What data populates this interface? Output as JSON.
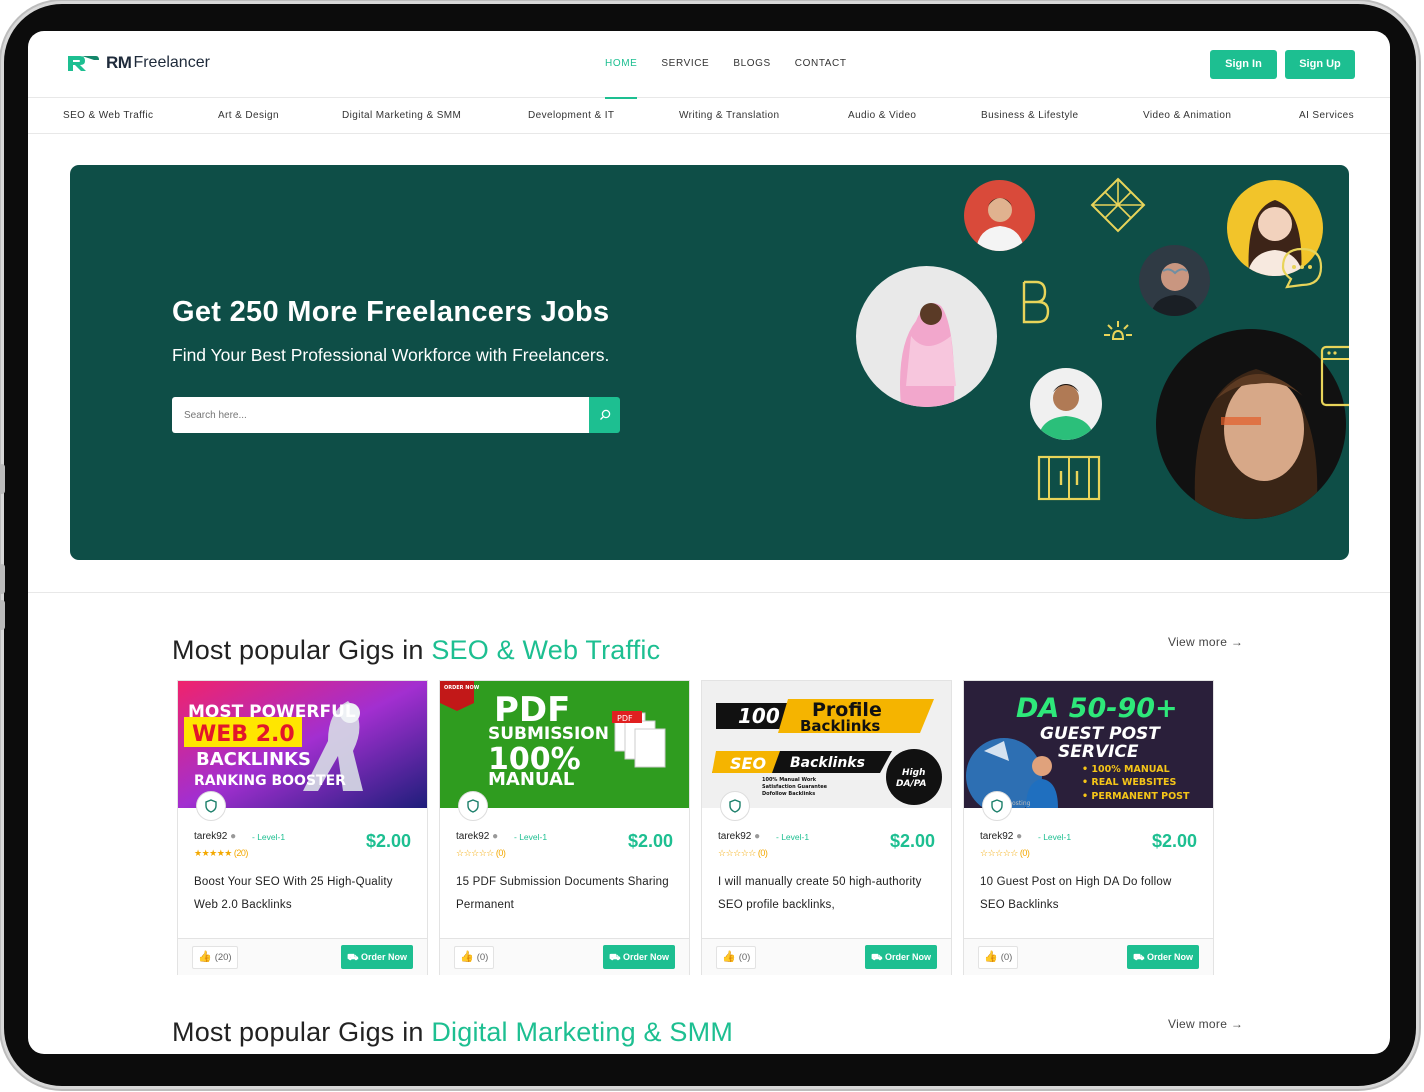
{
  "header": {
    "logo_rm": "RM",
    "logo_freelancer": "Freelancer",
    "nav": [
      "HOME",
      "SERVICE",
      "BLOGS",
      "CONTACT"
    ],
    "sign_in": "Sign In",
    "sign_up": "Sign Up"
  },
  "categories": [
    "SEO & Web Traffic",
    "Art & Design",
    "Digital Marketing & SMM",
    "Development & IT",
    "Writing & Translation",
    "Audio & Video",
    "Business & Lifestyle",
    "Video & Animation",
    "AI Services"
  ],
  "hero": {
    "title": "Get 250 More Freelancers Jobs",
    "subtitle": "Find Your Best Professional Workforce with Freelancers.",
    "search_placeholder": "Search here..."
  },
  "sections": [
    {
      "prefix": "Most popular Gigs in ",
      "highlight": "SEO & Web Traffic",
      "view_more": "View more"
    },
    {
      "prefix": "Most popular Gigs in ",
      "highlight": "Digital Marketing & SMM",
      "view_more": "View more"
    }
  ],
  "gigs": [
    {
      "seller": "tarek92",
      "level": "- Level-1",
      "stars": "★★★★★",
      "rating_count": "(20)",
      "price": "$2.00",
      "title": "Boost Your SEO With 25 High-Quality Web 2.0 Backlinks",
      "likes": "(20)",
      "order": "Order Now",
      "thumb": {
        "l1": "MOST POWERFUL",
        "l2": "WEB 2.0",
        "l3": "BACKLINKS",
        "l4": "RANKING BOOSTER"
      }
    },
    {
      "seller": "tarek92",
      "level": "- Level-1",
      "stars": "☆☆☆☆☆",
      "rating_count": "(0)",
      "price": "$2.00",
      "title": "15 PDF Submission Documents Sharing Permanent",
      "likes": "(0)",
      "order": "Order Now",
      "thumb": {
        "badge": "ORDER NOW",
        "l1": "PDF",
        "l2": "SUBMISSION",
        "l3": "100%",
        "l4": "MANUAL",
        "pdf": "PDF"
      }
    },
    {
      "seller": "tarek92",
      "level": "- Level-1",
      "stars": "☆☆☆☆☆",
      "rating_count": "(0)",
      "price": "$2.00",
      "title": "I will manually create 50 high-authority SEO profile backlinks,",
      "likes": "(0)",
      "order": "Order Now",
      "thumb": {
        "num": "100",
        "l1": "Profile",
        "l2": "Backlinks",
        "seo": "SEO",
        "bl": "Backlinks",
        "note1": "100% Manual Work",
        "note2": "Satisfaction Guarantee",
        "note3": "Dofollow Backlinks",
        "hi": "High",
        "da": "DA/PA"
      }
    },
    {
      "seller": "tarek92",
      "level": "- Level-1",
      "stars": "☆☆☆☆☆",
      "rating_count": "(0)",
      "price": "$2.00",
      "title": "10 Guest Post on High DA Do follow SEO Backlinks",
      "likes": "(0)",
      "order": "Order Now",
      "thumb": {
        "l1": "DA 50-90+",
        "l2": "GUEST POST",
        "l3": "SERVICE",
        "b1": "• 100% MANUAL",
        "b2": "• REAL WEBSITES",
        "b3": "• PERMANENT POST",
        "post": "osting"
      }
    }
  ],
  "colors": {
    "accent": "#1dbf91",
    "hero_bg": "#0e4e47",
    "gold": "#f5c518"
  }
}
